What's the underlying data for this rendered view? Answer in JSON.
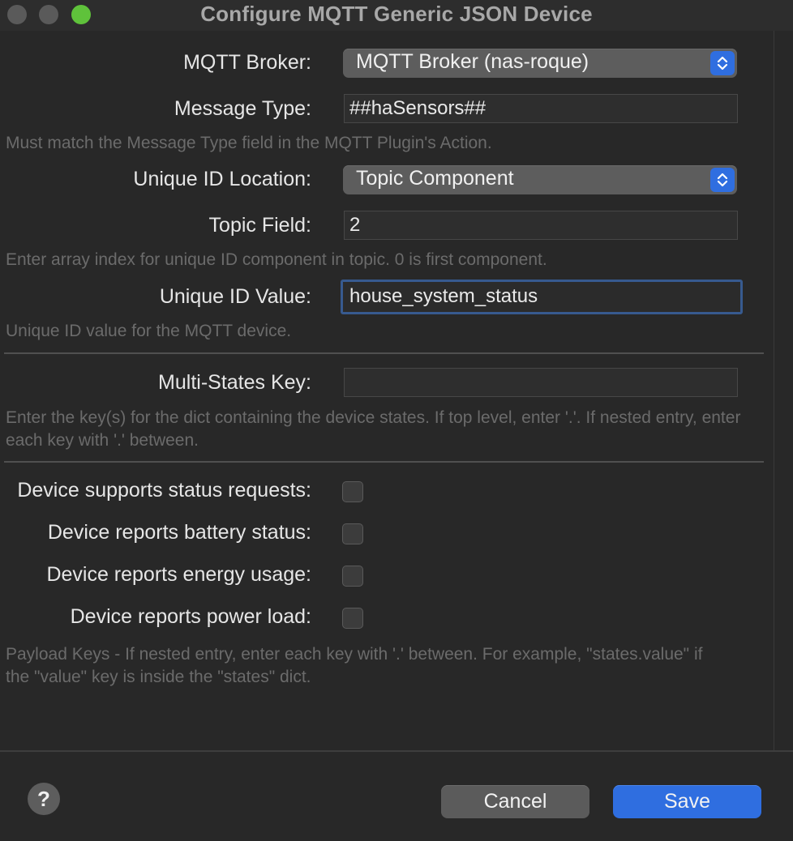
{
  "window": {
    "title": "Configure MQTT Generic JSON Device"
  },
  "form": {
    "broker_label": "MQTT Broker:",
    "broker_value": "MQTT Broker (nas-roque)",
    "message_type_label": "Message Type:",
    "message_type_value": "##haSensors##",
    "message_type_hint": "Must match the Message Type field in the MQTT Plugin's Action.",
    "uid_location_label": "Unique ID Location:",
    "uid_location_value": "Topic Component",
    "topic_field_label": "Topic Field:",
    "topic_field_value": "2",
    "topic_field_hint": "Enter array index for unique ID component in topic.  0 is first component.",
    "uid_value_label": "Unique ID Value:",
    "uid_value_value": "house_system_status",
    "uid_value_hint": "Unique ID value for the MQTT device.",
    "multi_states_label": "Multi-States Key:",
    "multi_states_value": "",
    "multi_states_hint": "Enter the key(s) for the dict containing the device states.  If top level, enter '.'.  If nested entry, enter each key with '.' between.",
    "checkboxes": [
      {
        "label": "Device supports status requests:",
        "checked": false
      },
      {
        "label": "Device reports battery status:",
        "checked": false
      },
      {
        "label": "Device reports energy usage:",
        "checked": false
      },
      {
        "label": "Device reports power load:",
        "checked": false
      }
    ],
    "payload_hint": "Payload Keys - If nested entry, enter each key with '.' between.  For example, \"states.value\" if the \"value\" key is inside the \"states\" dict."
  },
  "footer": {
    "help_label": "?",
    "cancel_label": "Cancel",
    "save_label": "Save"
  },
  "colors": {
    "accent": "#2f6ee0",
    "focus_ring": "#375a8f",
    "maximize": "#5fc23b"
  }
}
